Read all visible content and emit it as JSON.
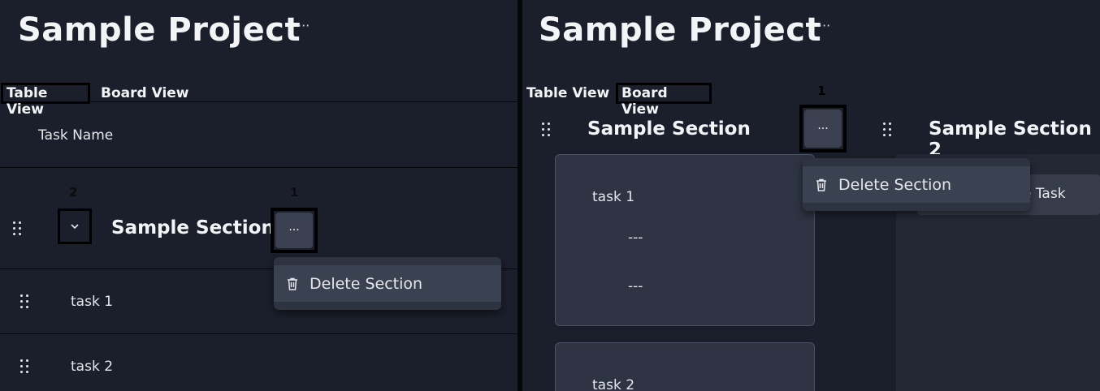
{
  "left": {
    "project_title": "Sample Project",
    "title_more": "···",
    "tabs": [
      {
        "label": "Table View"
      },
      {
        "label": "Board View"
      }
    ],
    "selected_tab": "Table View",
    "column_header": "Task Name",
    "section": {
      "name": "Sample Section",
      "more": "···",
      "marker_more": "1",
      "marker_chevron": "2"
    },
    "menu": {
      "delete_label": "Delete Section"
    },
    "tasks": [
      {
        "name": "task 1"
      },
      {
        "name": "task 2"
      }
    ]
  },
  "right": {
    "project_title": "Sample Project",
    "title_more": "···",
    "tabs": [
      {
        "label": "Table View"
      },
      {
        "label": "Board View"
      }
    ],
    "selected_tab": "Board View",
    "sections": [
      {
        "name": "Sample Section",
        "more": "···",
        "marker_more": "1"
      },
      {
        "name": "Sample Section 2"
      }
    ],
    "menu": {
      "delete_label": "Delete Section"
    },
    "cards": [
      {
        "name": "task 1",
        "fields": [
          "---",
          "---"
        ]
      },
      {
        "name": "task 2"
      }
    ],
    "partial_button": "e Task"
  }
}
